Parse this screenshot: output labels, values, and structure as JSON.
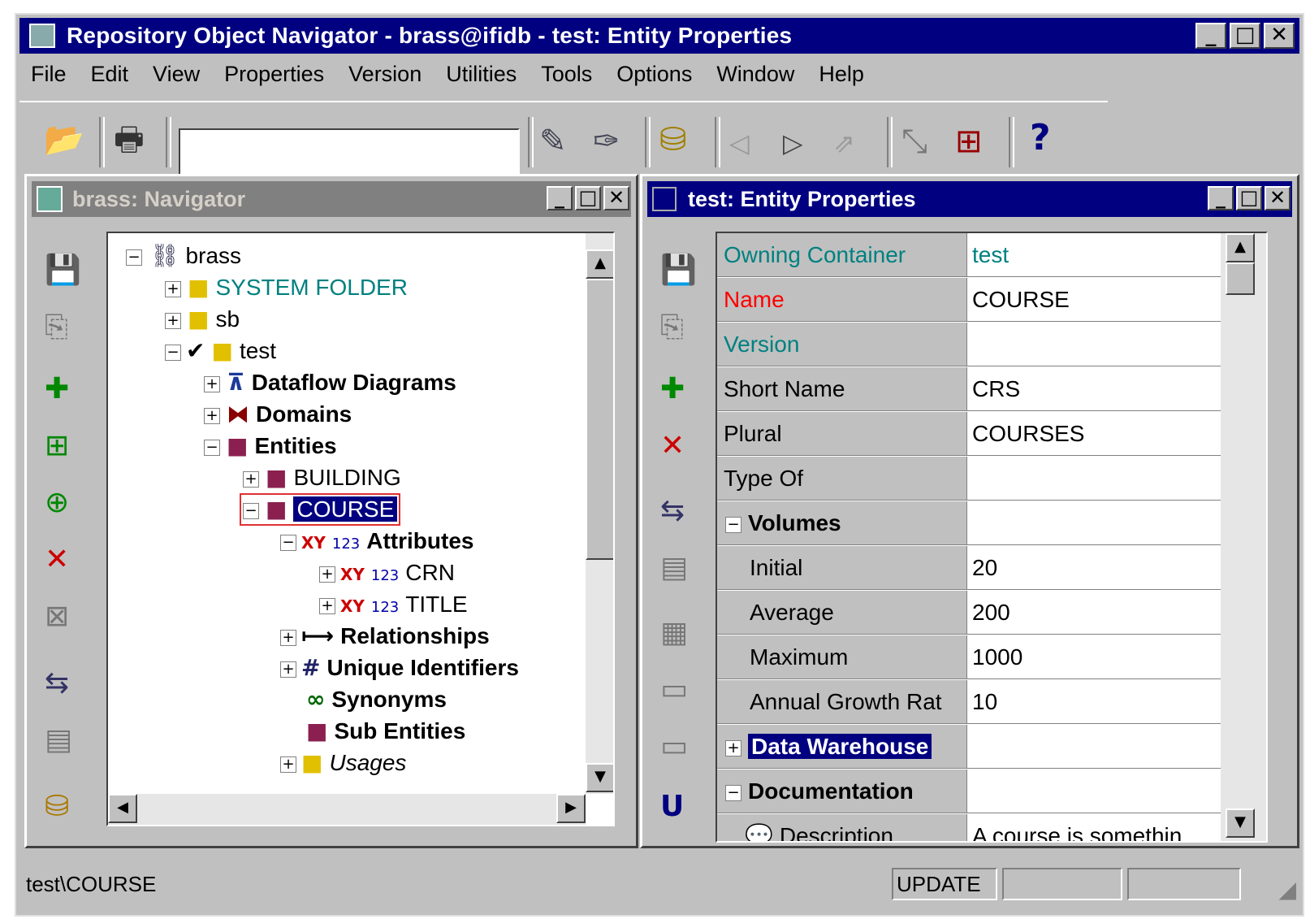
{
  "window": {
    "title": "Repository Object Navigator - brass@ifidb - test: Entity Properties"
  },
  "menu": [
    "File",
    "Edit",
    "View",
    "Properties",
    "Version",
    "Utilities",
    "Tools",
    "Options",
    "Window",
    "Help"
  ],
  "toolbar": {
    "search_value": ""
  },
  "navigator": {
    "title": "brass: Navigator",
    "tree": [
      {
        "label": "brass",
        "color": "#000000"
      },
      {
        "label": "SYSTEM FOLDER",
        "color": "#008080"
      },
      {
        "label": "sb",
        "color": "#000000"
      },
      {
        "label": "test",
        "color": "#000000"
      },
      {
        "label": "Dataflow Diagrams",
        "color": "#000000"
      },
      {
        "label": "Domains",
        "color": "#000000"
      },
      {
        "label": "Entities",
        "color": "#000000"
      },
      {
        "label": "BUILDING",
        "color": "#000000"
      },
      {
        "label": "COURSE",
        "color": "#ffffff"
      },
      {
        "label": "Attributes",
        "color": "#000000"
      },
      {
        "label": "CRN",
        "color": "#000000"
      },
      {
        "label": "TITLE",
        "color": "#000000"
      },
      {
        "label": "Relationships",
        "color": "#000000"
      },
      {
        "label": "Unique Identifiers",
        "color": "#000000"
      },
      {
        "label": "Synonyms",
        "color": "#000000"
      },
      {
        "label": "Sub Entities",
        "color": "#000000"
      },
      {
        "label": "Usages",
        "color": "#000000"
      }
    ],
    "xy_label": "XY",
    "num_label": "123"
  },
  "properties": {
    "title": "test: Entity Properties",
    "rows": [
      {
        "label": "Owning Container",
        "value": "test",
        "label_color": "#008080",
        "value_color": "#008080"
      },
      {
        "label": "Name",
        "value": "COURSE",
        "label_color": "#ff0000",
        "value_color": "#000000"
      },
      {
        "label": "Version",
        "value": "",
        "label_color": "#008080",
        "value_color": "#000000"
      },
      {
        "label": "Short Name",
        "value": "CRS",
        "label_color": "#000000",
        "value_color": "#000000"
      },
      {
        "label": "Plural",
        "value": "COURSES",
        "label_color": "#000000",
        "value_color": "#000000"
      },
      {
        "label": "Type Of",
        "value": "",
        "label_color": "#000000",
        "value_color": "#000000"
      },
      {
        "label": "Volumes",
        "value": "",
        "label_color": "#000000",
        "value_color": "#000000"
      },
      {
        "label": "Initial",
        "value": "20",
        "label_color": "#000000",
        "value_color": "#000000"
      },
      {
        "label": "Average",
        "value": "200",
        "label_color": "#000000",
        "value_color": "#000000"
      },
      {
        "label": "Maximum",
        "value": "1000",
        "label_color": "#000000",
        "value_color": "#000000"
      },
      {
        "label": "Annual Growth Rat",
        "value": "10",
        "label_color": "#000000",
        "value_color": "#000000"
      },
      {
        "label": "Data Warehouse",
        "value": "",
        "label_color": "#ffffff",
        "value_color": "#000000"
      },
      {
        "label": "Documentation",
        "value": "",
        "label_color": "#000000",
        "value_color": "#000000"
      },
      {
        "label": "Description",
        "value": "A course is somethin",
        "label_color": "#000000",
        "value_color": "#000000"
      }
    ]
  },
  "status": {
    "path": "test\\COURSE",
    "mode": "UPDATE"
  }
}
